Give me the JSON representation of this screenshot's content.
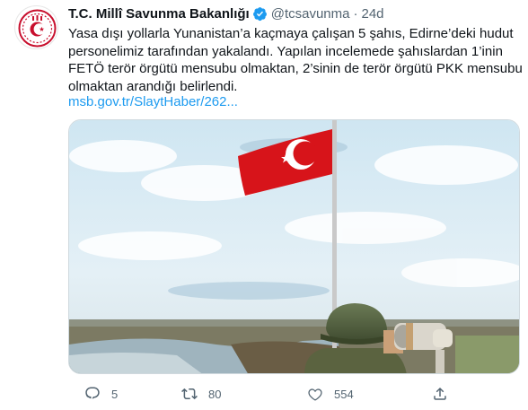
{
  "tweet": {
    "name": "T.C. Millî Savunma Bakanlığı",
    "handle": "@tcsavunma",
    "separator": "·",
    "time": "24d",
    "text_lines": [
      "Yasa dışı yollarla Yunanistan’a kaçmaya çalışan 5 şahıs, Edirne’deki hudut",
      "personelimiz tarafından yakalandı. Yapılan incelemede şahıslardan 1’inin",
      "FETÖ terör örgütü mensubu olmaktan, 2’sinin de terör örgütü PKK mensubu",
      "olmaktan arandığı belirlendi."
    ],
    "link": "msb.gov.tr/SlaytHaber/262...",
    "colors": {
      "brand_red": "#c8102e",
      "verified_blue": "#1d9bf0",
      "link_blue": "#1d9bf0",
      "muted_gray": "#536471"
    }
  },
  "actions": {
    "reply": {
      "icon": "reply-icon",
      "count": "5"
    },
    "retweet": {
      "icon": "retweet-icon",
      "count": "80"
    },
    "like": {
      "icon": "heart-icon",
      "count": "554"
    },
    "share": {
      "icon": "share-icon",
      "count": ""
    }
  }
}
